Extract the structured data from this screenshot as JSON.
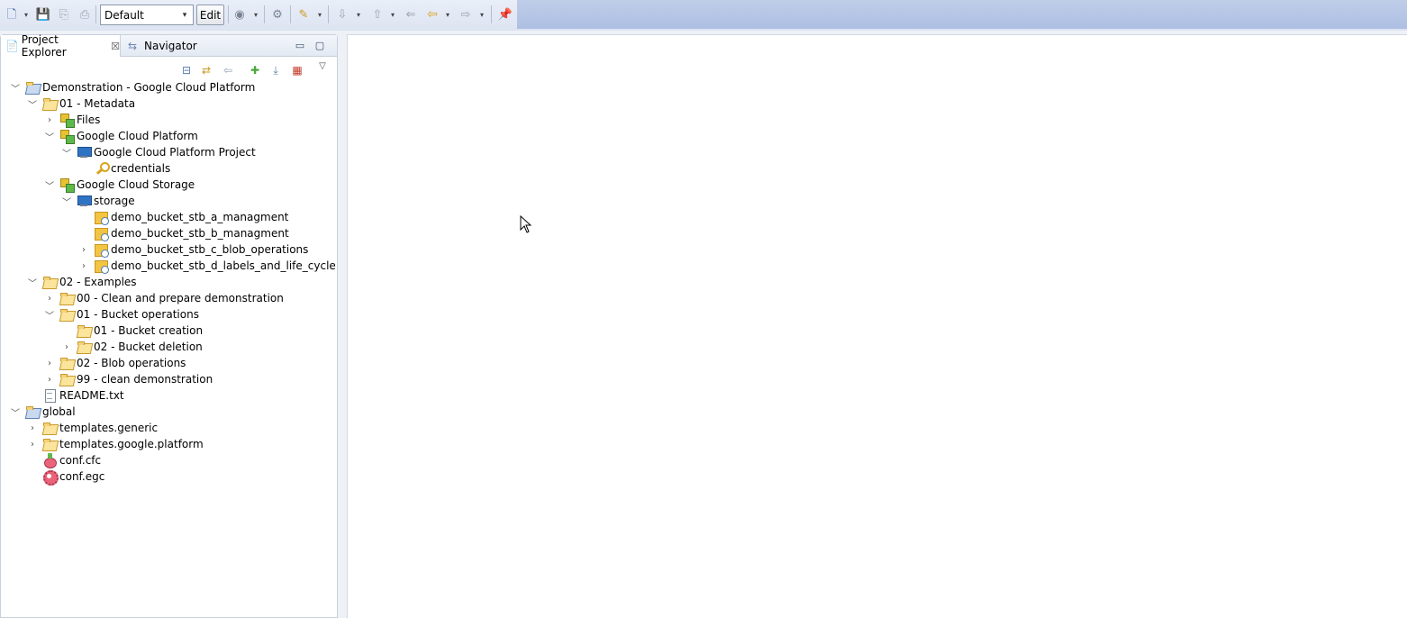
{
  "toolbar": {
    "perspective_value": "Default",
    "perspective_options": [
      "Default"
    ],
    "edit_label": "Edit",
    "icons": [
      "new-icon",
      "save-icon",
      "save-all-icon",
      "print-icon",
      "run-icon",
      "debug-icon",
      "tool-icon",
      "next-annotation-icon",
      "previous-annotation-icon",
      "last-edit-icon",
      "back-icon",
      "forward-icon",
      "pin-icon"
    ],
    "glyphs": {
      "new": "🗋",
      "dd": "▾",
      "save": "💾",
      "save_all": "⎘",
      "print": "⎙",
      "run": "◉",
      "debug": "⚙",
      "tool": "✎",
      "next": "⇩",
      "prev": "⇧",
      "last_edit": "⇐",
      "back": "⇦",
      "forward": "⇨",
      "pin": "📌"
    }
  },
  "explorer": {
    "tabs": [
      {
        "label": "Project Explorer",
        "close": "☒",
        "icon": "project-explorer-icon",
        "glyph": "📄"
      },
      {
        "label": "Navigator",
        "icon": "navigator-icon",
        "glyph": "⇆"
      }
    ],
    "window_buttons": {
      "minimize": "▭",
      "maximize": "▢"
    },
    "view_toolbar": {
      "collapse_all": "⊟",
      "link_editor": "⇄",
      "back": "⇦",
      "new_connection": "✚",
      "import": "⤓",
      "hierarchy": "▦",
      "view_menu": "▽"
    }
  },
  "tree": [
    {
      "label": "Demonstration - Google Cloud Platform",
      "depth": 0,
      "toggle": "﹀",
      "icon": "project-folder-icon"
    },
    {
      "label": "01 - Metadata",
      "depth": 1,
      "toggle": "﹀",
      "icon": "folder-open-icon"
    },
    {
      "label": "Files",
      "depth": 2,
      "toggle": "›",
      "icon": "connection-icon"
    },
    {
      "label": "Google Cloud Platform",
      "depth": 2,
      "toggle": "﹀",
      "icon": "connection-icon"
    },
    {
      "label": "Google Cloud Platform Project",
      "depth": 3,
      "toggle": "﹀",
      "icon": "monitor-icon"
    },
    {
      "label": "credentials",
      "depth": 4,
      "toggle": "",
      "icon": "key-icon"
    },
    {
      "label": "Google Cloud Storage",
      "depth": 2,
      "toggle": "﹀",
      "icon": "connection-icon"
    },
    {
      "label": "storage",
      "depth": 3,
      "toggle": "﹀",
      "icon": "monitor-icon"
    },
    {
      "label": "demo_bucket_stb_a_managment",
      "depth": 4,
      "toggle": "",
      "icon": "bucket-icon"
    },
    {
      "label": "demo_bucket_stb_b_managment",
      "depth": 4,
      "toggle": "",
      "icon": "bucket-icon"
    },
    {
      "label": "demo_bucket_stb_c_blob_operations",
      "depth": 4,
      "toggle": "›",
      "icon": "bucket-icon"
    },
    {
      "label": "demo_bucket_stb_d_labels_and_life_cycle",
      "depth": 4,
      "toggle": "›",
      "icon": "bucket-icon"
    },
    {
      "label": "02 - Examples",
      "depth": 1,
      "toggle": "﹀",
      "icon": "folder-open-icon"
    },
    {
      "label": "00 - Clean and prepare demonstration",
      "depth": 2,
      "toggle": "›",
      "icon": "folder-open-icon"
    },
    {
      "label": "01 - Bucket operations",
      "depth": 2,
      "toggle": "﹀",
      "icon": "folder-open-icon"
    },
    {
      "label": "01 - Bucket creation",
      "depth": 3,
      "toggle": "",
      "icon": "folder-open-icon"
    },
    {
      "label": "02 - Bucket deletion",
      "depth": 3,
      "toggle": "›",
      "icon": "folder-open-icon"
    },
    {
      "label": "02 - Blob operations",
      "depth": 2,
      "toggle": "›",
      "icon": "folder-open-icon"
    },
    {
      "label": "99 - clean demonstration",
      "depth": 2,
      "toggle": "›",
      "icon": "folder-open-icon"
    },
    {
      "label": "README.txt",
      "depth": 1,
      "toggle": "",
      "icon": "text-file-icon"
    },
    {
      "label": "global",
      "depth": 0,
      "toggle": "﹀",
      "icon": "project-folder-icon"
    },
    {
      "label": "templates.generic",
      "depth": 1,
      "toggle": "›",
      "icon": "folder-open-icon"
    },
    {
      "label": "templates.google.platform",
      "depth": 1,
      "toggle": "›",
      "icon": "folder-open-icon"
    },
    {
      "label": "conf.cfc",
      "depth": 1,
      "toggle": "",
      "icon": "cfc-file-icon"
    },
    {
      "label": "conf.egc",
      "depth": 1,
      "toggle": "",
      "icon": "egc-file-icon"
    }
  ],
  "colors": {
    "toolbar_accent": "#aebfe3",
    "panel_border": "#c7d0de",
    "selection": "#cde8ff"
  }
}
